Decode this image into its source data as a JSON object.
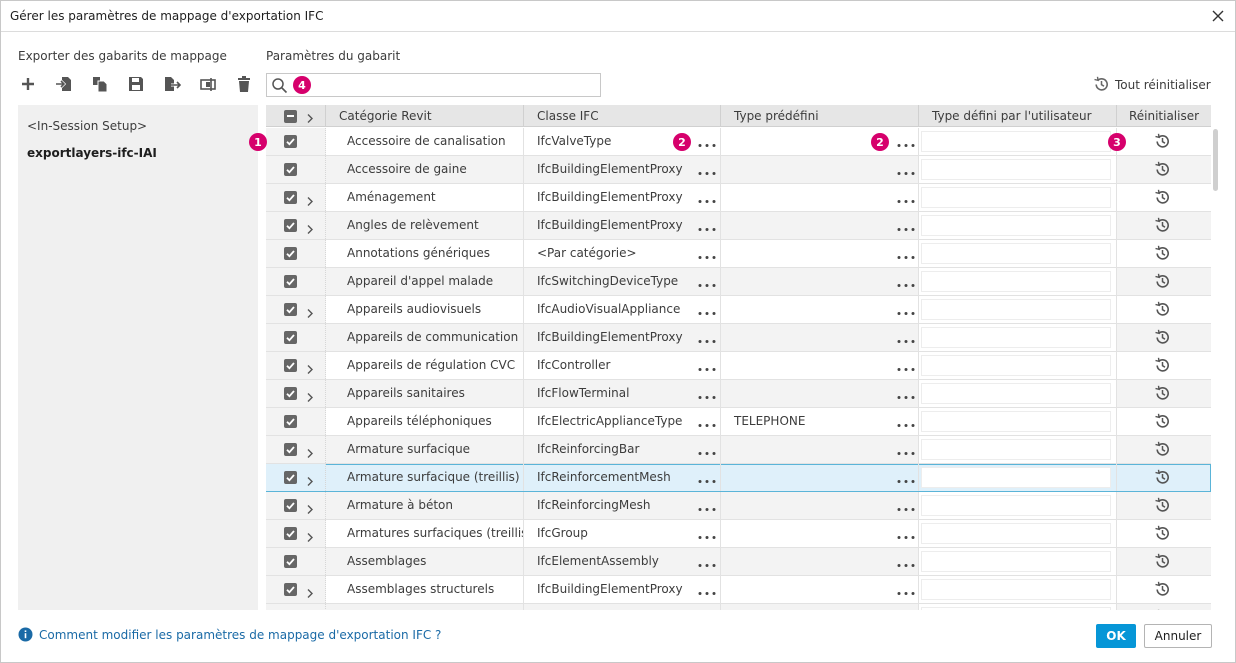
{
  "window": {
    "title": "Gérer les paramètres de mappage d'exportation IFC",
    "close_icon": "close-icon"
  },
  "left_panel": {
    "heading": "Exporter des gabarits de mappage",
    "toolbar": [
      {
        "name": "new-template-button",
        "icon": "plus-icon"
      },
      {
        "name": "import-template-button",
        "icon": "import-icon"
      },
      {
        "name": "duplicate-template-button",
        "icon": "duplicate-icon"
      },
      {
        "name": "save-template-button",
        "icon": "save-icon"
      },
      {
        "name": "export-template-button",
        "icon": "export-icon"
      },
      {
        "name": "rename-template-button",
        "icon": "rename-icon"
      },
      {
        "name": "delete-template-button",
        "icon": "trash-icon"
      }
    ],
    "templates": [
      "<In-Session Setup>",
      "exportlayers-ifc-IAI"
    ],
    "selected_template": "exportlayers-ifc-IAI"
  },
  "right_panel": {
    "heading": "Paramètres du gabarit",
    "search": {
      "value": "",
      "placeholder": ""
    },
    "reset_all_label": "Tout réinitialiser"
  },
  "badges": [
    "1",
    "2",
    "2",
    "3",
    "4"
  ],
  "table": {
    "columns": [
      "Catégorie Revit",
      "Classe IFC",
      "Type prédéfini",
      "Type défini par l'utilisateur",
      "Réinitialiser"
    ],
    "rows": [
      {
        "category": "Accessoire de canalisation",
        "ifc_class": "IfcValveType",
        "predefined": "",
        "user_defined": "",
        "expandable": false,
        "checked": true
      },
      {
        "category": "Accessoire de gaine",
        "ifc_class": "IfcBuildingElementProxy",
        "predefined": "",
        "user_defined": "",
        "expandable": false,
        "checked": true
      },
      {
        "category": "Aménagement",
        "ifc_class": "IfcBuildingElementProxy",
        "predefined": "",
        "user_defined": "",
        "expandable": true,
        "checked": true
      },
      {
        "category": "Angles de relèvement",
        "ifc_class": "IfcBuildingElementProxy",
        "predefined": "",
        "user_defined": "",
        "expandable": true,
        "checked": true
      },
      {
        "category": "Annotations génériques",
        "ifc_class": "<Par catégorie>",
        "predefined": "",
        "user_defined": "",
        "expandable": false,
        "checked": true
      },
      {
        "category": "Appareil d'appel malade",
        "ifc_class": "IfcSwitchingDeviceType",
        "predefined": "",
        "user_defined": "",
        "expandable": false,
        "checked": true
      },
      {
        "category": "Appareils audiovisuels",
        "ifc_class": "IfcAudioVisualAppliance",
        "predefined": "",
        "user_defined": "",
        "expandable": true,
        "checked": true
      },
      {
        "category": "Appareils de communication",
        "ifc_class": "IfcBuildingElementProxy",
        "predefined": "",
        "user_defined": "",
        "expandable": false,
        "checked": true
      },
      {
        "category": "Appareils de régulation CVC",
        "ifc_class": "IfcController",
        "predefined": "",
        "user_defined": "",
        "expandable": true,
        "checked": true
      },
      {
        "category": "Appareils sanitaires",
        "ifc_class": "IfcFlowTerminal",
        "predefined": "",
        "user_defined": "",
        "expandable": true,
        "checked": true
      },
      {
        "category": "Appareils téléphoniques",
        "ifc_class": "IfcElectricApplianceType",
        "predefined": "TELEPHONE",
        "user_defined": "",
        "expandable": false,
        "checked": true
      },
      {
        "category": "Armature surfacique",
        "ifc_class": "IfcReinforcingBar",
        "predefined": "",
        "user_defined": "",
        "expandable": true,
        "checked": true
      },
      {
        "category": "Armature surfacique (treillis)",
        "ifc_class": "IfcReinforcementMesh",
        "predefined": "",
        "user_defined": "",
        "expandable": true,
        "checked": true,
        "selected": true
      },
      {
        "category": "Armature à béton",
        "ifc_class": "IfcReinforcingMesh",
        "predefined": "",
        "user_defined": "",
        "expandable": true,
        "checked": true
      },
      {
        "category": "Armatures surfaciques (treillis)",
        "ifc_class": "IfcGroup",
        "predefined": "",
        "user_defined": "",
        "expandable": true,
        "checked": true
      },
      {
        "category": "Assemblages",
        "ifc_class": "IfcElementAssembly",
        "predefined": "",
        "user_defined": "",
        "expandable": false,
        "checked": true
      },
      {
        "category": "Assemblages structurels",
        "ifc_class": "IfcBuildingElementProxy",
        "predefined": "",
        "user_defined": "",
        "expandable": true,
        "checked": true
      },
      {
        "category": "",
        "ifc_class": "",
        "predefined": "",
        "user_defined": "",
        "expandable": false,
        "checked": true
      }
    ]
  },
  "footer": {
    "help_link": "Comment modifier les paramètres de mappage d'exportation IFC ?",
    "ok_label": "OK",
    "cancel_label": "Annuler"
  },
  "colors": {
    "accent": "#0696d7",
    "badge": "#d6006c",
    "selected_row": "#dff0fa",
    "link": "#1a6aa6"
  }
}
